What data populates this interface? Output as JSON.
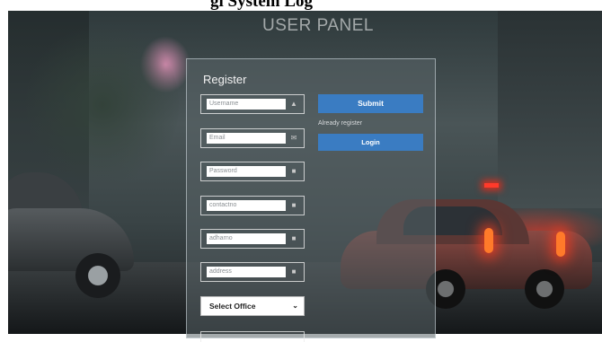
{
  "page": {
    "title_fragment": "gi System Log"
  },
  "header": {
    "title": "USER PANEL"
  },
  "form": {
    "title": "Register",
    "fields": [
      {
        "placeholder": "Username",
        "icon": "user-icon"
      },
      {
        "placeholder": "Email",
        "icon": "envelope-icon"
      },
      {
        "placeholder": "Password",
        "icon": "lock-icon"
      },
      {
        "placeholder": "contactno",
        "icon": "lock-icon"
      },
      {
        "placeholder": "adharno",
        "icon": "lock-icon"
      },
      {
        "placeholder": "address",
        "icon": "lock-icon"
      }
    ],
    "office_select": {
      "selected": "Select Office"
    }
  },
  "actions": {
    "submit_label": "Submit",
    "already_text": "Already register",
    "login_label": "Login"
  },
  "colors": {
    "primary_button": "#3a7cc2",
    "panel_border": "#dce6eb"
  }
}
